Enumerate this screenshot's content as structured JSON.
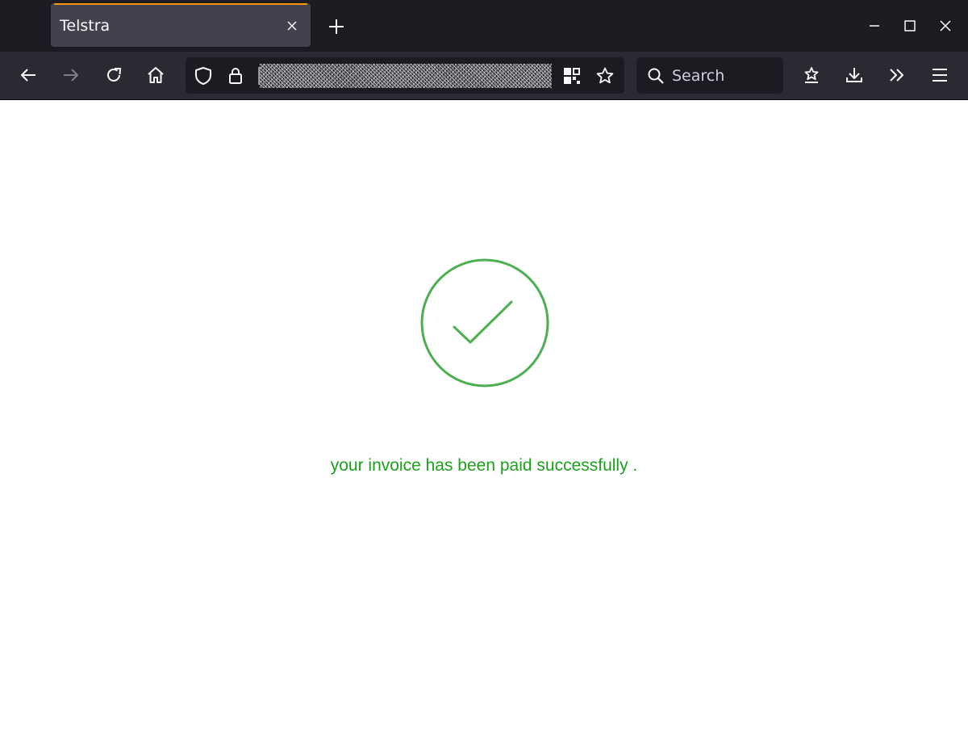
{
  "browser": {
    "tab": {
      "title": "Telstra"
    },
    "search": {
      "placeholder": "Search"
    },
    "colors": {
      "tab_accent": "#ff9500",
      "chrome_dark": "#1c1b22",
      "toolbar": "#2b2a33",
      "tab_active": "#42414d"
    },
    "icons": {
      "tab_close": "close-icon",
      "new_tab": "plus-icon",
      "back": "arrow-left-icon",
      "forward": "arrow-right-icon",
      "reload": "reload-icon",
      "home": "home-icon",
      "tracking": "shield-icon",
      "lock": "lock-icon",
      "qr": "qr-code-icon",
      "bookmark": "star-icon",
      "pocket": "pocket-icon",
      "downloads": "download-icon",
      "overflow": "chevron-double-right-icon",
      "menu": "hamburger-menu-icon"
    }
  },
  "page": {
    "message": "your invoice has been paid successfully .",
    "colors": {
      "success": "#1aa21a",
      "check_stroke": "#4caf50"
    }
  }
}
